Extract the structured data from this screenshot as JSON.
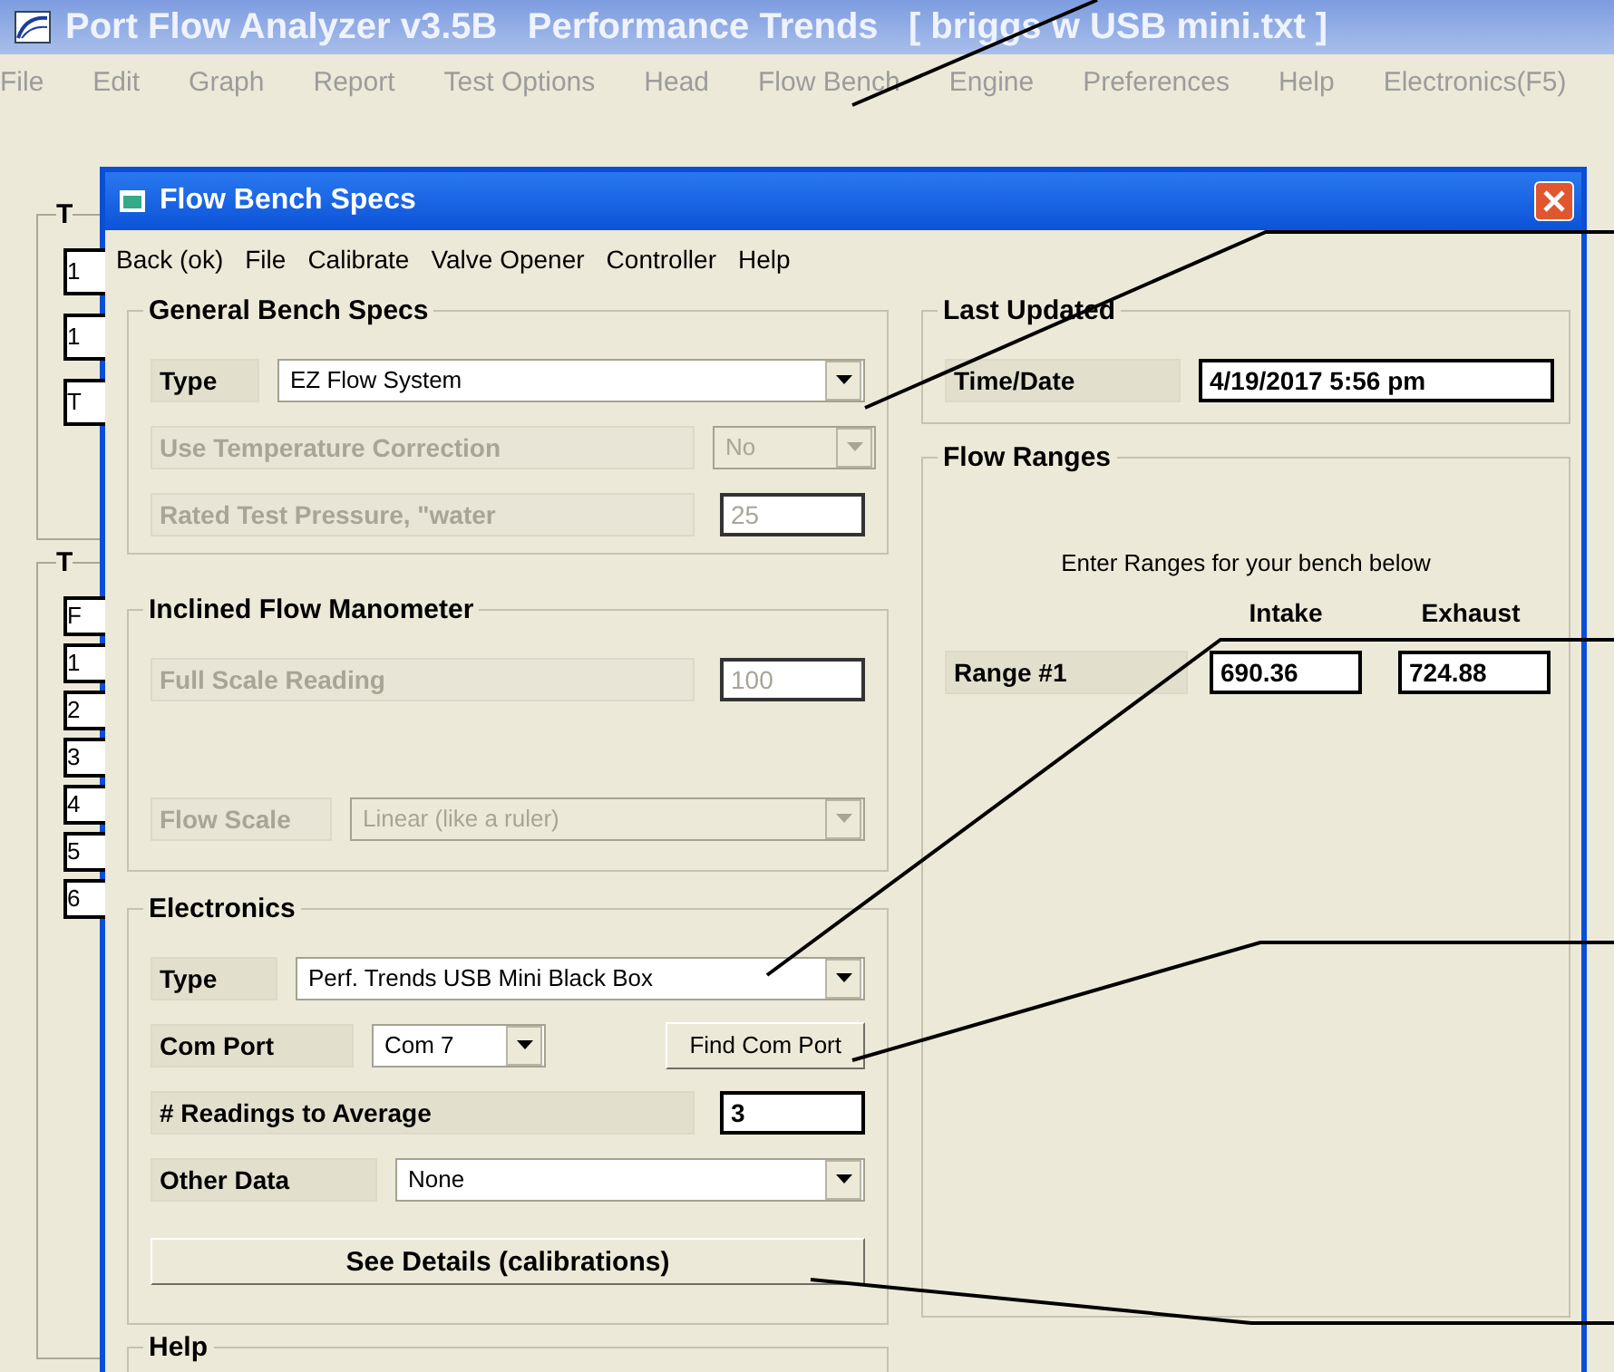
{
  "app": {
    "title": "Port Flow Analyzer v3.5B   Performance Trends   [ briggs w USB mini.txt ]",
    "menu": [
      "File",
      "Edit",
      "Graph",
      "Report",
      "Test Options",
      "Head",
      "Flow Bench",
      "Engine",
      "Preferences",
      "Help",
      "Electronics(F5)"
    ]
  },
  "back_panel": {
    "frames": [
      {
        "title": "T",
        "items": [
          "1",
          "1",
          "T"
        ]
      },
      {
        "title": "T",
        "items": [
          "F",
          "1",
          "2",
          "3",
          "4",
          "5",
          "6"
        ]
      }
    ]
  },
  "dialog": {
    "title": "Flow Bench Specs",
    "menu": [
      "Back (ok)",
      "File",
      "Calibrate",
      "Valve Opener",
      "Controller",
      "Help"
    ],
    "groups": [
      {
        "title": "General Bench Specs",
        "rows": [
          {
            "kind": "dropdown",
            "label": "Type",
            "value": "EZ Flow System",
            "disabled": false
          },
          {
            "kind": "dropdown",
            "label": "Use Temperature Correction",
            "value": "No",
            "disabled": true
          },
          {
            "kind": "input",
            "label": "Rated Test Pressure, \"water",
            "value": "25",
            "disabled": true
          }
        ]
      },
      {
        "title": "Inclined Flow Manometer",
        "rows": [
          {
            "kind": "input",
            "label": "Full Scale Reading",
            "value": "100",
            "disabled": true
          },
          {
            "kind": "dropdown",
            "label": "Flow Scale",
            "value": "Linear (like a ruler)",
            "disabled": true
          }
        ]
      },
      {
        "title": "Electronics",
        "rows": [
          {
            "kind": "dropdown",
            "label": "Type",
            "value": "Perf. Trends USB Mini Black Box",
            "disabled": false
          },
          {
            "kind": "dropdown-button",
            "label": "Com Port",
            "value": "Com 7",
            "button": "Find Com Port",
            "disabled": false
          },
          {
            "kind": "input",
            "label": "# Readings to Average",
            "value": "3",
            "disabled": false
          },
          {
            "kind": "dropdown",
            "label": "Other Data",
            "value": "None",
            "disabled": false
          },
          {
            "kind": "button",
            "button": "See Details (calibrations)",
            "disabled": false
          }
        ]
      },
      {
        "title": "Help"
      }
    ],
    "last_updated": {
      "title": "Last Updated",
      "label": "Time/Date",
      "value": "4/19/2017  5:56 pm"
    },
    "flow_ranges": {
      "title": "Flow Ranges",
      "note": "Enter Ranges for your bench below",
      "columns": [
        "Intake",
        "Exhaust"
      ],
      "rows": [
        {
          "label": "Range #1",
          "values": [
            "690.36",
            "724.88"
          ]
        }
      ]
    }
  }
}
